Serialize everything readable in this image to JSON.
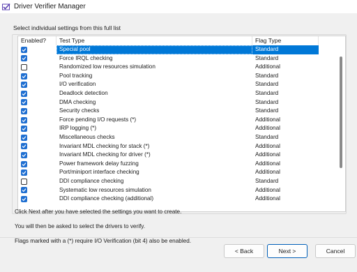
{
  "window": {
    "title": "Driver Verifier Manager"
  },
  "group_label": "Select individual settings from this full list",
  "columns": [
    "Enabled?",
    "Test Type",
    "Flag Type"
  ],
  "rows": [
    {
      "enabled": true,
      "test": "Special pool",
      "flag": "Standard",
      "selected": true
    },
    {
      "enabled": true,
      "test": "Force IRQL checking",
      "flag": "Standard"
    },
    {
      "enabled": false,
      "test": "Randomized low resources simulation",
      "flag": "Additional"
    },
    {
      "enabled": true,
      "test": "Pool tracking",
      "flag": "Standard"
    },
    {
      "enabled": true,
      "test": "I/O verification",
      "flag": "Standard"
    },
    {
      "enabled": true,
      "test": "Deadlock detection",
      "flag": "Standard"
    },
    {
      "enabled": true,
      "test": "DMA checking",
      "flag": "Standard"
    },
    {
      "enabled": true,
      "test": "Security checks",
      "flag": "Standard"
    },
    {
      "enabled": true,
      "test": "Force pending I/O requests (*)",
      "flag": "Additional"
    },
    {
      "enabled": true,
      "test": "IRP logging (*)",
      "flag": "Additional"
    },
    {
      "enabled": true,
      "test": "Miscellaneous checks",
      "flag": "Standard"
    },
    {
      "enabled": true,
      "test": "Invariant MDL checking for stack (*)",
      "flag": "Additional"
    },
    {
      "enabled": true,
      "test": "Invariant MDL checking for driver (*)",
      "flag": "Additional"
    },
    {
      "enabled": true,
      "test": "Power framework delay fuzzing",
      "flag": "Additional"
    },
    {
      "enabled": true,
      "test": "Port/miniport interface checking",
      "flag": "Additional"
    },
    {
      "enabled": false,
      "test": "DDI compliance checking",
      "flag": "Standard"
    },
    {
      "enabled": true,
      "test": "Systematic low resources simulation",
      "flag": "Additional"
    },
    {
      "enabled": true,
      "test": "DDI compliance checking (additional)",
      "flag": "Additional"
    }
  ],
  "instructions": {
    "line1": "Click Next after you have selected the settings you want to create.",
    "line2": "You will then be asked to select the drivers to verify.",
    "line3": "Flags marked with a (*) require I/O Verification (bit 4) also be enabled."
  },
  "buttons": {
    "back": "< Back",
    "next": "Next >",
    "cancel": "Cancel"
  },
  "colors": {
    "selection": "#0078d7",
    "checkbox": "#1f6fd1"
  }
}
